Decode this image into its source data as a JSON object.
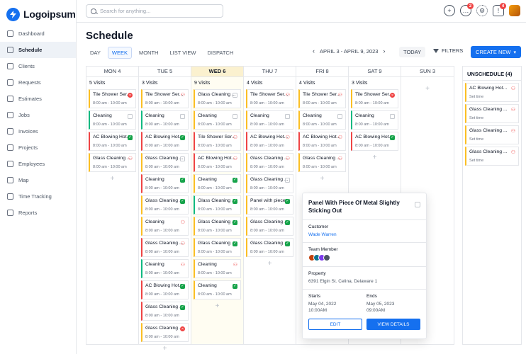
{
  "app": {
    "logo_text": "Logoipsum"
  },
  "sidebar": {
    "items": [
      {
        "label": "Dashboard",
        "icon": "dashboard-icon"
      },
      {
        "label": "Schedule",
        "icon": "calendar-icon",
        "active": true
      },
      {
        "label": "Clients",
        "icon": "clients-icon"
      },
      {
        "label": "Requests",
        "icon": "requests-icon"
      },
      {
        "label": "Estimates",
        "icon": "estimates-icon"
      },
      {
        "label": "Jobs",
        "icon": "jobs-icon"
      },
      {
        "label": "Invoices",
        "icon": "invoices-icon"
      },
      {
        "label": "Projects",
        "icon": "projects-icon"
      },
      {
        "label": "Employees",
        "icon": "employees-icon"
      },
      {
        "label": "Map",
        "icon": "map-icon"
      },
      {
        "label": "Time Tracking",
        "icon": "time-tracking-icon"
      },
      {
        "label": "Reports",
        "icon": "reports-icon"
      }
    ]
  },
  "topbar": {
    "search_placeholder": "Search for anything...",
    "messages_badge": "2",
    "notifications_badge": "4"
  },
  "page": {
    "title": "Schedule"
  },
  "views": [
    "DAY",
    "WEEK",
    "MONTH",
    "LIST VIEW",
    "DISPATCH"
  ],
  "active_view": "WEEK",
  "date_range": "APRIL 3 - APRIL 9, 2023",
  "today_label": "TODAY",
  "filters_label": "FILTERS",
  "create_label": "CREATE NEW",
  "colors": {
    "accent": "#1570ef",
    "green": "#10b981",
    "red": "#ef4444",
    "yellow": "#fbbf24"
  },
  "days": [
    {
      "name": "MON 4",
      "visits": "5 Visits",
      "events": [
        {
          "title": "Tile Shower Ser...",
          "time": "8:00 am - 10:00 am",
          "color": "yellow",
          "status": "error"
        },
        {
          "title": "Cleaning",
          "time": "8:00 am - 10:00 am",
          "color": "green",
          "status": "empty"
        },
        {
          "title": "AC Blowing Hot...",
          "time": "8:00 am - 10:00 am",
          "color": "red",
          "status": "check"
        },
        {
          "title": "Glass Cleaning ...",
          "time": "8:00 am - 10:00 am",
          "color": "yellow",
          "status": "person"
        }
      ]
    },
    {
      "name": "TUE 5",
      "visits": "3 Visits",
      "events": [
        {
          "title": "Tile Shower Ser...",
          "time": "8:00 am - 10:00 am",
          "color": "yellow",
          "status": "person"
        },
        {
          "title": "Cleaning",
          "time": "8:00 am - 10:00 am",
          "color": "green",
          "status": "empty"
        },
        {
          "title": "AC Blowing Hot...",
          "time": "8:00 am - 10:00 am",
          "color": "red",
          "status": "check"
        },
        {
          "title": "Glass Cleaning ...",
          "time": "8:00 am - 10:00 am",
          "color": "yellow",
          "status": "empty"
        },
        {
          "title": "Cleaning",
          "time": "8:00 am - 10:00 am",
          "color": "red",
          "status": "check"
        },
        {
          "title": "Glass Cleaning ...",
          "time": "8:00 am - 10:00 am",
          "color": "yellow",
          "status": "check"
        },
        {
          "title": "Cleaning",
          "time": "8:00 am - 10:00 am",
          "color": "yellow",
          "status": "person"
        },
        {
          "title": "Glass Cleaning ...",
          "time": "8:00 am - 10:00 am",
          "color": "red",
          "status": "person"
        },
        {
          "title": "Cleaning",
          "time": "8:00 am - 10:00 am",
          "color": "green",
          "status": "person"
        },
        {
          "title": "AC Blowing Hot...",
          "time": "8:00 am - 10:00 am",
          "color": "red",
          "status": "check"
        },
        {
          "title": "Glass Cleaning ...",
          "time": "8:00 am - 10:00 am",
          "color": "red",
          "status": "check"
        },
        {
          "title": "Glass Cleaning ...",
          "time": "8:00 am - 10:00 am",
          "color": "yellow",
          "status": "error"
        }
      ]
    },
    {
      "name": "WED 6",
      "visits": "9 Visits",
      "today": true,
      "events": [
        {
          "title": "Glass Cleaning ...",
          "time": "8:00 am - 10:00 am",
          "color": "yellow",
          "status": "empty"
        },
        {
          "title": "Cleaning",
          "time": "8:00 am - 10:00 am",
          "color": "yellow",
          "status": "empty"
        },
        {
          "title": "Tile Shower Ser...",
          "time": "8:00 am - 10:00 am",
          "color": "red",
          "status": "person"
        },
        {
          "title": "AC Blowing Hot...",
          "time": "8:00 am - 10:00 am",
          "color": "red",
          "status": "person"
        },
        {
          "title": "Cleaning",
          "time": "8:00 am - 10:00 am",
          "color": "yellow",
          "status": "check"
        },
        {
          "title": "Glass Cleaning ...",
          "time": "8:00 am - 10:00 am",
          "color": "green",
          "status": "check"
        },
        {
          "title": "Glass Cleaning ...",
          "time": "8:00 am - 10:00 am",
          "color": "yellow",
          "status": "check"
        },
        {
          "title": "Glass Cleaning ...",
          "time": "8:00 am - 10:00 am",
          "color": "yellow",
          "status": "check"
        },
        {
          "title": "Cleaning",
          "time": "8:00 am - 10:00 am",
          "color": "yellow",
          "status": "person"
        },
        {
          "title": "Cleaning",
          "time": "8:00 am - 10:00 am",
          "color": "yellow",
          "status": "check"
        }
      ]
    },
    {
      "name": "THU 7",
      "visits": "4 Visits",
      "events": [
        {
          "title": "Tile Shower Ser...",
          "time": "8:00 am - 10:00 am",
          "color": "yellow",
          "status": "person"
        },
        {
          "title": "Cleaning",
          "time": "8:00 am - 10:00 am",
          "color": "yellow",
          "status": "empty"
        },
        {
          "title": "AC Blowing Hot...",
          "time": "8:00 am - 10:00 am",
          "color": "red",
          "status": "person"
        },
        {
          "title": "Glass Cleaning ...",
          "time": "8:00 am - 10:00 am",
          "color": "yellow",
          "status": "person"
        },
        {
          "title": "Glass Cleaning ...",
          "time": "8:00 am - 10:00 am",
          "color": "yellow",
          "status": "empty"
        },
        {
          "title": "Panel with piece...",
          "time": "8:00 am - 10:00 am",
          "color": "yellow",
          "status": "check"
        },
        {
          "title": "Glass Cleaning ...",
          "time": "8:00 am - 10:00 am",
          "color": "yellow",
          "status": "check"
        },
        {
          "title": "Glass Cleaning ...",
          "time": "8:00 am - 10:00 am",
          "color": "yellow",
          "status": "check"
        }
      ]
    },
    {
      "name": "FRI 8",
      "visits": "4 Visits",
      "events": [
        {
          "title": "Tile Shower Ser...",
          "time": "8:00 am - 10:00 am",
          "color": "yellow",
          "status": "person"
        },
        {
          "title": "Cleaning",
          "time": "8:00 am - 10:00 am",
          "color": "yellow",
          "status": "empty"
        },
        {
          "title": "AC Blowing Hot...",
          "time": "8:00 am - 10:00 am",
          "color": "red",
          "status": "person"
        },
        {
          "title": "Glass Cleaning ...",
          "time": "8:00 am - 10:00 am",
          "color": "yellow",
          "status": "person"
        }
      ]
    },
    {
      "name": "SAT 9",
      "visits": "3 Visits",
      "events": [
        {
          "title": "Tile Shower Ser...",
          "time": "8:00 am - 10:00 am",
          "color": "yellow",
          "status": "error"
        },
        {
          "title": "Cleaning",
          "time": "8:00 am - 10:00 am",
          "color": "green",
          "status": "empty"
        },
        {
          "title": "AC Blowing Hot...",
          "time": "8:00 am - 10:00 am",
          "color": "red",
          "status": "check"
        }
      ]
    },
    {
      "name": "SUN 3",
      "visits": "",
      "events": []
    }
  ],
  "unscheduled": {
    "title": "UNSCHEDULE (4)",
    "items": [
      {
        "title": "AC Blowing Hot...",
        "sub": "Set time"
      },
      {
        "title": "Glass Cleaning ...",
        "sub": "Set time"
      },
      {
        "title": "Glass Cleaning ...",
        "sub": "Set time"
      },
      {
        "title": "Glass Cleaning ...",
        "sub": "Set time"
      }
    ]
  },
  "popup": {
    "title": "Panel With Piece Of Metal Slightly Sticking Out",
    "customer_label": "Customer",
    "customer": "Wade Warren",
    "team_label": "Team Member",
    "property_label": "Property",
    "property": "6391 Elgin St. Celina, Delaware 1",
    "starts_label": "Starts",
    "starts_date": "May 04, 2022",
    "starts_time": "10:00AM",
    "ends_label": "Ends",
    "ends_date": "May 05, 2023",
    "ends_time": "09:00AM",
    "edit_label": "EDIT",
    "view_label": "VIEW DETAILS"
  }
}
